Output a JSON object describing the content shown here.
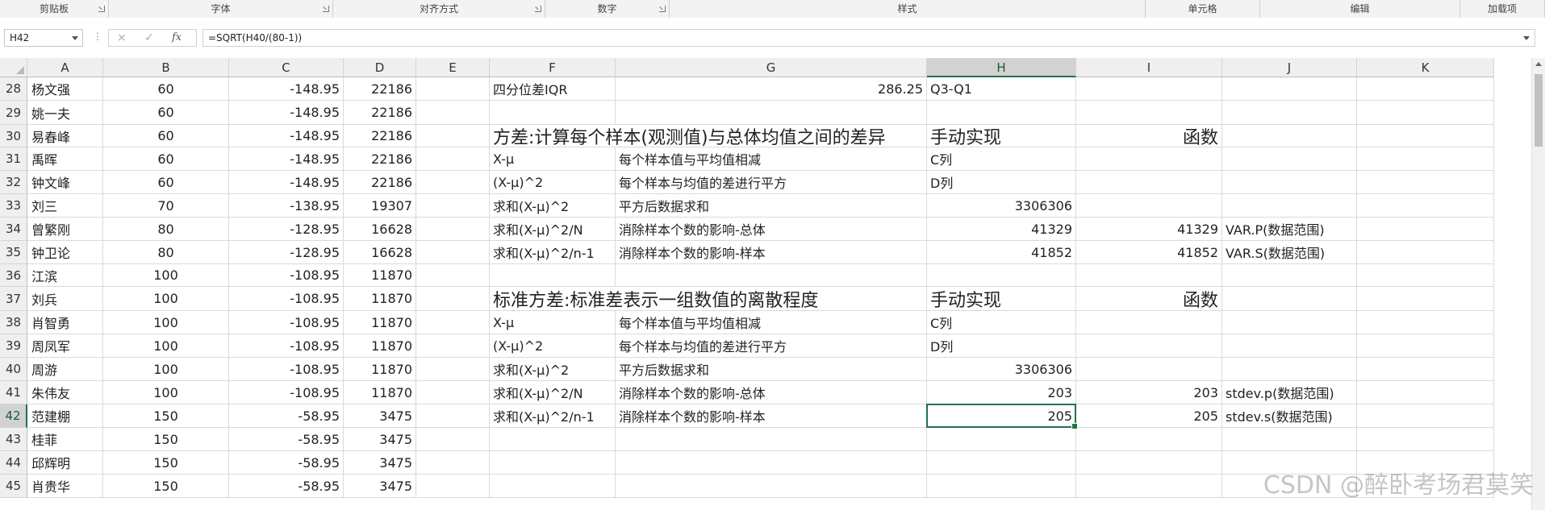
{
  "ribbon": {
    "groups": [
      "剪贴板",
      "字体",
      "对齐方式",
      "数字",
      "样式",
      "单元格",
      "编辑",
      "加载项"
    ]
  },
  "formula_bar": {
    "name_box": "H42",
    "more_icon": "vertical-ellipsis",
    "cancel_icon": "×",
    "enter_icon": "✓",
    "fx_label": "fx",
    "formula": "=SQRT(H40/(80-1))"
  },
  "grid": {
    "columns": [
      "A",
      "B",
      "C",
      "D",
      "E",
      "F",
      "G",
      "H",
      "I",
      "J",
      "K"
    ],
    "selected_column": "H",
    "selected_row": "42",
    "selected_cell": "H42",
    "rows": [
      {
        "num": "28",
        "A": "杨文强",
        "B": "60",
        "C": "-148.95",
        "D": "22186",
        "F": "四分位差IQR",
        "G": "286.25",
        "H": "Q3-Q1"
      },
      {
        "num": "29",
        "A": "姚一夫",
        "B": "60",
        "C": "-148.95",
        "D": "22186"
      },
      {
        "num": "30",
        "A": "易春峰",
        "B": "60",
        "C": "-148.95",
        "D": "22186",
        "F": "方差:计算每个样本(观测值)与总体均值之间的差异",
        "H": "手动实现",
        "I": "函数"
      },
      {
        "num": "31",
        "A": "禹晖",
        "B": "60",
        "C": "-148.95",
        "D": "22186",
        "F": "X-μ",
        "G": "每个样本值与平均值相减",
        "H": "C列"
      },
      {
        "num": "32",
        "A": "钟文峰",
        "B": "60",
        "C": "-148.95",
        "D": "22186",
        "F": "(X-μ)^2",
        "G": "每个样本与均值的差进行平方",
        "H": "D列"
      },
      {
        "num": "33",
        "A": "刘三",
        "B": "70",
        "C": "-138.95",
        "D": "19307",
        "F": "求和(X-μ)^2",
        "G": "平方后数据求和",
        "H": "3306306"
      },
      {
        "num": "34",
        "A": "曾繁刚",
        "B": "80",
        "C": "-128.95",
        "D": "16628",
        "F": "求和(X-μ)^2/N",
        "G": "消除样本个数的影响-总体",
        "H": "41329",
        "I": "41329",
        "J": "VAR.P(数据范围)"
      },
      {
        "num": "35",
        "A": "钟卫论",
        "B": "80",
        "C": "-128.95",
        "D": "16628",
        "F": "求和(X-μ)^2/n-1",
        "G": "消除样本个数的影响-样本",
        "H": "41852",
        "I": "41852",
        "J": "VAR.S(数据范围)"
      },
      {
        "num": "36",
        "A": "江滨",
        "B": "100",
        "C": "-108.95",
        "D": "11870"
      },
      {
        "num": "37",
        "A": "刘兵",
        "B": "100",
        "C": "-108.95",
        "D": "11870",
        "F": "标准方差:标准差表示一组数值的离散程度",
        "H": "手动实现",
        "I": "函数"
      },
      {
        "num": "38",
        "A": "肖智勇",
        "B": "100",
        "C": "-108.95",
        "D": "11870",
        "F": "X-μ",
        "G": "每个样本值与平均值相减",
        "H": "C列"
      },
      {
        "num": "39",
        "A": "周凤军",
        "B": "100",
        "C": "-108.95",
        "D": "11870",
        "F": "(X-μ)^2",
        "G": "每个样本与均值的差进行平方",
        "H": "D列"
      },
      {
        "num": "40",
        "A": "周游",
        "B": "100",
        "C": "-108.95",
        "D": "11870",
        "F": "求和(X-μ)^2",
        "G": "平方后数据求和",
        "H": "3306306"
      },
      {
        "num": "41",
        "A": "朱伟友",
        "B": "100",
        "C": "-108.95",
        "D": "11870",
        "F": "求和(X-μ)^2/N",
        "G": "消除样本个数的影响-总体",
        "H": "203",
        "I": "203",
        "J": "stdev.p(数据范围)"
      },
      {
        "num": "42",
        "A": "范建棚",
        "B": "150",
        "C": "-58.95",
        "D": "3475",
        "F": "求和(X-μ)^2/n-1",
        "G": "消除样本个数的影响-样本",
        "H": "205",
        "I": "205",
        "J": "stdev.s(数据范围)"
      },
      {
        "num": "43",
        "A": "桂菲",
        "B": "150",
        "C": "-58.95",
        "D": "3475"
      },
      {
        "num": "44",
        "A": "邱辉明",
        "B": "150",
        "C": "-58.95",
        "D": "3475"
      },
      {
        "num": "45",
        "A": "肖贵华",
        "B": "150",
        "C": "-58.95",
        "D": "3475"
      }
    ]
  },
  "watermark": "CSDN @醉卧考场君莫笑",
  "colors": {
    "accent_green": "#217346",
    "header_bg": "#efefef",
    "selected_header_bg": "#d2d2d2",
    "gridline": "#dadada"
  }
}
